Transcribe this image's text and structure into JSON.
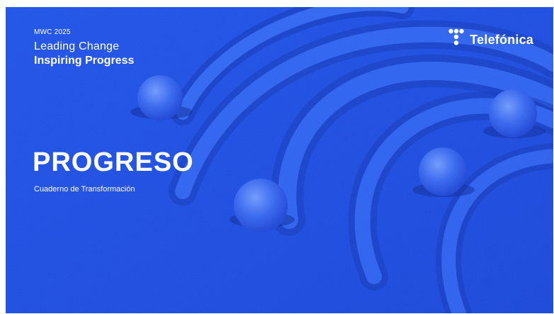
{
  "header": {
    "event": "MWC 2025",
    "tagline_line1": "Leading Change",
    "tagline_line2": "Inspiring Progress"
  },
  "brand": {
    "name": "Telefónica",
    "logo_icon": "telefonica-t-icon"
  },
  "cover": {
    "title": "PROGRESO",
    "subtitle": "Cuaderno de Transformación"
  },
  "colors": {
    "background": "#1b4fe6",
    "ridge_light": "#3a6ff5",
    "ridge_shadow": "#0d2fb0",
    "sphere": "#3d74ff",
    "text": "#ffffff"
  }
}
